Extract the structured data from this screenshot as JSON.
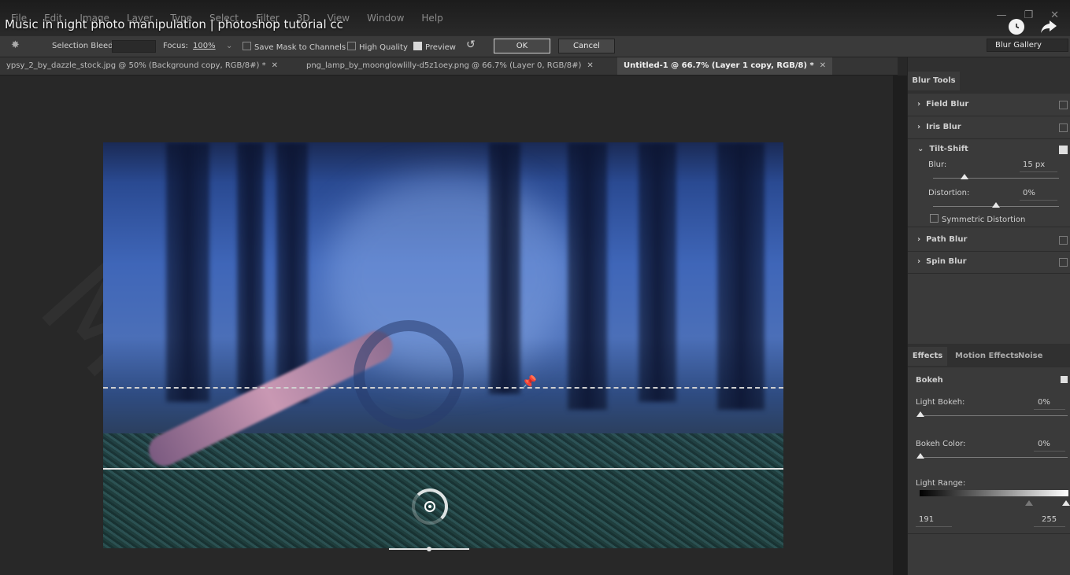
{
  "video": {
    "title": "Music in night photo manipulation | photoshop tutorial cc"
  },
  "menu": [
    "File",
    "Edit",
    "Image",
    "Layer",
    "Type",
    "Select",
    "Filter",
    "3D",
    "View",
    "Window",
    "Help"
  ],
  "options": {
    "selection_bleed_label": "Selection Bleed:",
    "focus_label": "Focus:",
    "focus_value": "100%",
    "save_mask_label": "Save Mask to Channels",
    "high_quality_label": "High Quality",
    "preview_label": "Preview",
    "ok_label": "OK",
    "cancel_label": "Cancel",
    "workspace_value": "Blur Gallery"
  },
  "tabs": [
    {
      "label": "ypsy_2_by_dazzle_stock.jpg @ 50% (Background copy, RGB/8#) *"
    },
    {
      "label": "png_lamp_by_moonglowlilly-d5z1oey.png @ 66.7% (Layer 0, RGB/8#)"
    },
    {
      "label": "Untitled-1 @ 66.7% (Layer 1 copy, RGB/8) *"
    }
  ],
  "blur_tools": {
    "title": "Blur Tools",
    "field_blur": "Field Blur",
    "iris_blur": "Iris Blur",
    "tilt_shift": "Tilt-Shift",
    "blur_label": "Blur:",
    "blur_value": "15 px",
    "blur_level": 0.25,
    "distortion_label": "Distortion:",
    "distortion_value": "0%",
    "distortion_level": 0.5,
    "symmetric_label": "Symmetric Distortion",
    "path_blur": "Path Blur",
    "spin_blur": "Spin Blur"
  },
  "effects": {
    "tab_effects": "Effects",
    "tab_motion": "Motion Effects",
    "tab_noise": "Noise",
    "bokeh_label": "Bokeh",
    "light_bokeh_label": "Light Bokeh:",
    "light_bokeh_value": "0%",
    "bokeh_color_label": "Bokeh Color:",
    "bokeh_color_value": "0%",
    "light_range_label": "Light Range:",
    "range_min": "191",
    "range_max": "255"
  },
  "colors": {
    "accent_frame": "#d0d0d0",
    "panel": "#3a3a3a",
    "canvas": "#282828"
  }
}
